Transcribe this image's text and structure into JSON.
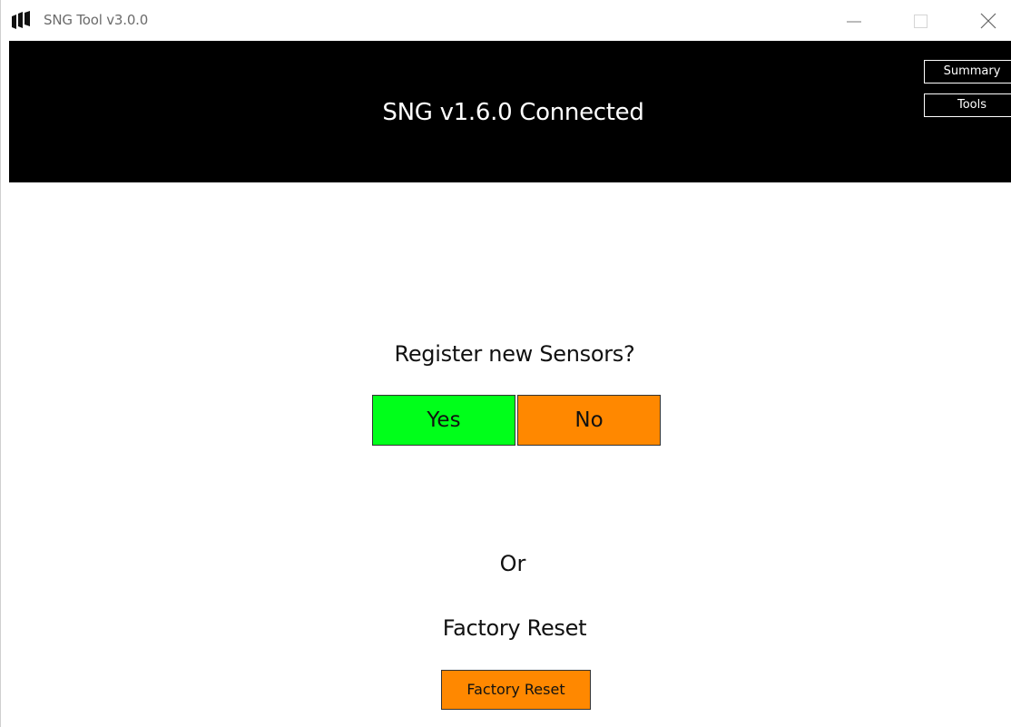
{
  "window": {
    "title": "SNG Tool v3.0.0"
  },
  "header": {
    "status": "SNG v1.6.0 Connected",
    "nav": {
      "summary_label": "Summary",
      "tools_label": "Tools"
    }
  },
  "main": {
    "prompt": "Register new Sensors?",
    "yes_label": "Yes",
    "no_label": "No",
    "or_text": "Or",
    "reset_heading": "Factory Reset",
    "reset_button_label": "Factory Reset"
  },
  "colors": {
    "header_bg": "#000000",
    "yes_bg": "#00ff1a",
    "no_bg": "#ff8800",
    "reset_bg": "#ff8800"
  },
  "icons": {
    "app": "app-logo-icon",
    "minimize": "minimize-icon",
    "maximize": "maximize-icon",
    "close": "close-icon"
  }
}
